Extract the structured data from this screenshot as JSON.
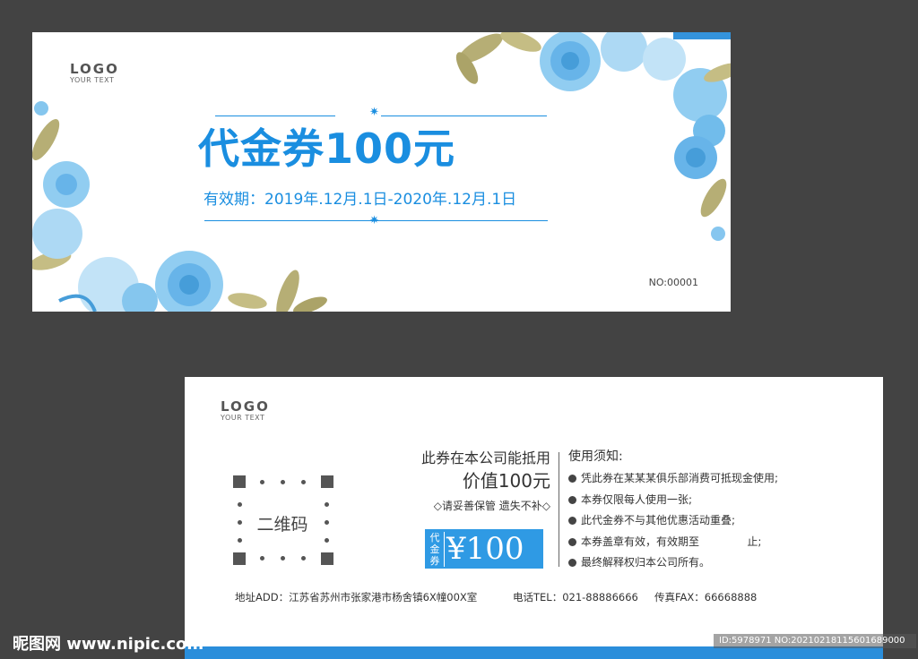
{
  "front": {
    "logo": "LOGO",
    "logo_sub": "YOUR TEXT",
    "title": "代金券100元",
    "validity": "有效期：2019年.12月.1日-2020年.12月.1日",
    "serial": "NO:00001",
    "star_glyph": "✷"
  },
  "back": {
    "logo": "LOGO",
    "logo_sub": "YOUR TEXT",
    "qr_label": "二维码",
    "offset_text": "此券在本公司能抵用",
    "value_text": "价值100元",
    "care_text": "◇请妥善保管 遗失不补◇",
    "price_tag": "代金券",
    "price_value": "¥100",
    "notes_title": "使用须知:",
    "notes": [
      "凭此券在某某某俱乐部消费可抵现金使用;",
      "本券仅限每人使用一张;",
      "此代金券不与其他优惠活动重叠;",
      "本券盖章有效，有效期至              止;",
      "最终解释权归本公司所有。"
    ],
    "address": "地址ADD：江苏省苏州市张家港市杨舍镇6X幢00X室",
    "phone": "电话TEL：021-88886666",
    "fax": "传真FAX：66668888"
  },
  "watermark": {
    "site": "昵图网 www.nipic.com",
    "id": "ID:5978971 NO:20210218115601689000"
  },
  "colors": {
    "accent": "#1a8ee0",
    "price_bg": "#2f9ae4",
    "background": "#434343",
    "leaf": "#b3aa6e",
    "flower": "#7fc3ee"
  }
}
